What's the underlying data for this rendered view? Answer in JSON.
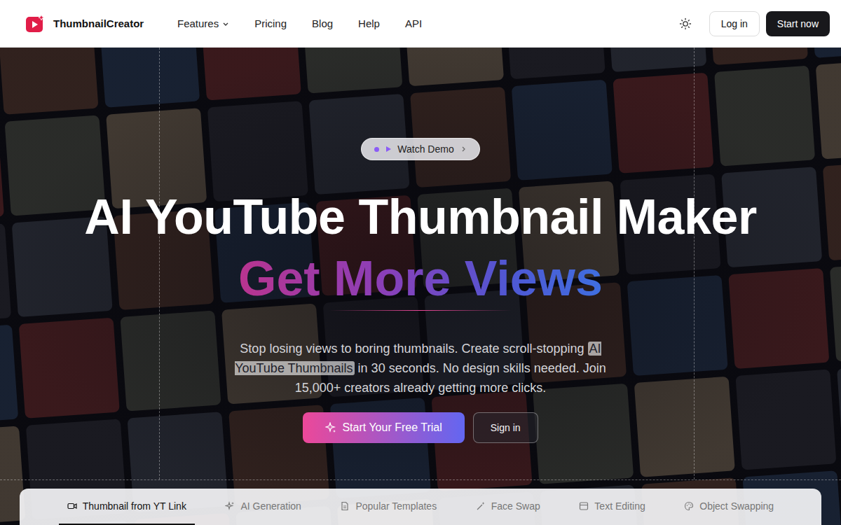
{
  "brand": {
    "name": "ThumbnailCreator"
  },
  "nav": {
    "items": [
      {
        "label": "Features",
        "dropdown": true
      },
      {
        "label": "Pricing",
        "dropdown": false
      },
      {
        "label": "Blog",
        "dropdown": false
      },
      {
        "label": "Help",
        "dropdown": false
      },
      {
        "label": "API",
        "dropdown": false
      }
    ],
    "login": "Log in",
    "cta": "Start now"
  },
  "hero": {
    "demo": "Watch Demo",
    "title": "AI YouTube Thumbnail Maker",
    "highlight": "Get More Views",
    "intro": "Stop losing views to boring thumbnails. Create scroll-stopping",
    "introHighlight": "AI YouTube Thumbnails",
    "outro": "in 30 seconds. No design skills needed. Join 15,000+ creators already getting more clicks.",
    "primary": "Start Your Free Trial",
    "secondary": "Sign in"
  },
  "tabs": [
    {
      "label": "Thumbnail from YT Link",
      "selected": true
    },
    {
      "label": "AI Generation",
      "selected": false
    },
    {
      "label": "Popular Templates",
      "selected": false
    },
    {
      "label": "Face Swap",
      "selected": false
    },
    {
      "label": "Text Editing",
      "selected": false
    },
    {
      "label": "Object Swapping",
      "selected": false
    }
  ]
}
